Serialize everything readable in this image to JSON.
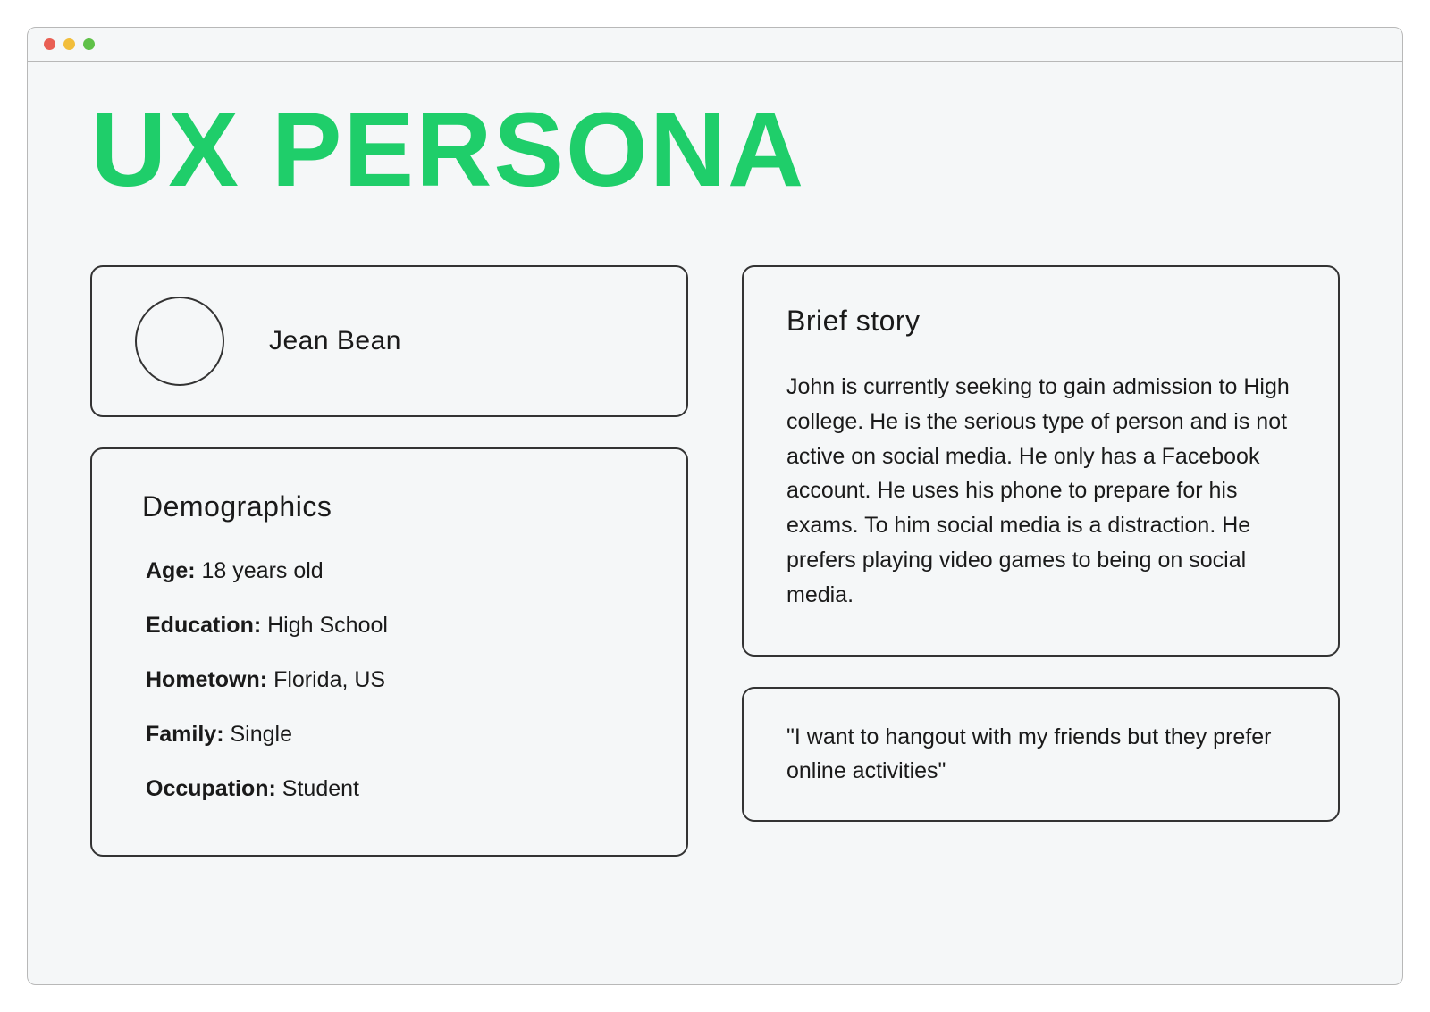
{
  "header": {
    "title": "UX PERSONA"
  },
  "persona": {
    "name": "Jean Bean"
  },
  "demographics": {
    "heading": "Demographics",
    "items": [
      {
        "label": "Age:",
        "value": "18 years old"
      },
      {
        "label": "Education:",
        "value": "High School"
      },
      {
        "label": "Hometown:",
        "value": "Florida, US"
      },
      {
        "label": "Family:",
        "value": "Single"
      },
      {
        "label": "Occupation:",
        "value": "Student"
      }
    ]
  },
  "story": {
    "heading": "Brief story",
    "text": "John is currently seeking to gain admission to High college. He is the serious type of person and is not active on social media. He only has a Facebook account. He uses his phone to prepare for his exams. To him social media is a distraction. He prefers playing video games to being on social media."
  },
  "quote": {
    "text": "\"I want to hangout with my friends but they prefer online activities\""
  }
}
